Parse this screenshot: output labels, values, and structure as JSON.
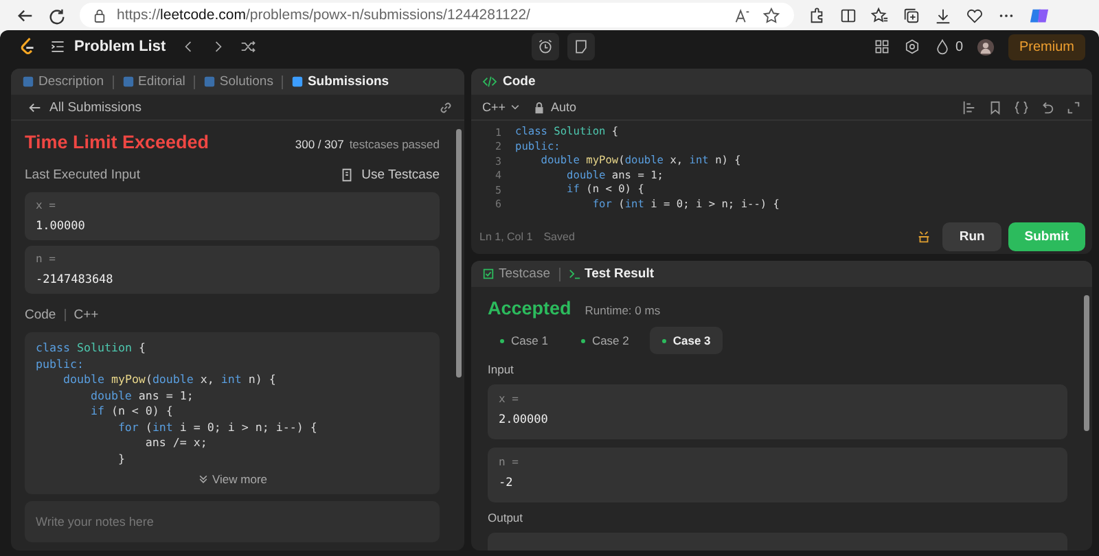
{
  "browser": {
    "url": "https://**leetcode.com**/problems/powx-n/submissions/1244281122/"
  },
  "header": {
    "title": "Problem List",
    "streak": "0",
    "premium": "Premium"
  },
  "left_tabs": [
    {
      "label": "Description",
      "selected": false
    },
    {
      "label": "Editorial",
      "selected": false
    },
    {
      "label": "Solutions",
      "selected": false
    },
    {
      "label": "Submissions",
      "selected": true
    }
  ],
  "submission": {
    "back": "All Submissions",
    "status": "Time Limit Exceeded",
    "passed": "300 / 307",
    "passed_label": "testcases passed",
    "input_label": "Last Executed Input",
    "use_testcase": "Use Testcase",
    "inputs": [
      {
        "name": "x =",
        "value": "1.00000"
      },
      {
        "name": "n =",
        "value": "-2147483648"
      }
    ],
    "code_label": "Code",
    "language": "C++",
    "code": [
      [
        {
          "text": "class ",
          "kind": "kw"
        },
        {
          "text": "Solution",
          "kind": "type"
        },
        {
          "text": " {",
          "kind": "plain"
        }
      ],
      [
        {
          "text": "public:",
          "kind": "kw"
        }
      ],
      [
        {
          "text": "    double ",
          "kind": "kw"
        },
        {
          "text": "myPow",
          "kind": "fn"
        },
        {
          "text": "(",
          "kind": "plain"
        },
        {
          "text": "double",
          "kind": "kw"
        },
        {
          "text": " x, ",
          "kind": "plain"
        },
        {
          "text": "int",
          "kind": "kw"
        },
        {
          "text": " n) {",
          "kind": "plain"
        }
      ],
      [
        {
          "text": "        double",
          "kind": "kw"
        },
        {
          "text": " ans = 1;",
          "kind": "plain"
        }
      ],
      [
        {
          "text": "        if",
          "kind": "kw"
        },
        {
          "text": " (n < 0) {",
          "kind": "plain"
        }
      ],
      [
        {
          "text": "            for",
          "kind": "kw"
        },
        {
          "text": " (",
          "kind": "plain"
        },
        {
          "text": "int",
          "kind": "kw"
        },
        {
          "text": " i = 0; i > n; i--) {",
          "kind": "plain"
        }
      ],
      [
        {
          "text": "                ans /= x;",
          "kind": "plain"
        }
      ],
      [
        {
          "text": "            }",
          "kind": "plain"
        }
      ]
    ],
    "view_more": "View more",
    "notes_placeholder": "Write your notes here"
  },
  "editor": {
    "title": "Code",
    "language": "C++",
    "mode": "Auto",
    "lines": [
      {
        "number": "1",
        "tokens": [
          {
            "text": "class ",
            "kind": "kw"
          },
          {
            "text": "Solution",
            "kind": "type"
          },
          {
            "text": " {",
            "kind": "plain"
          }
        ]
      },
      {
        "number": "2",
        "tokens": [
          {
            "text": "public:",
            "kind": "kw"
          }
        ]
      },
      {
        "number": "3",
        "tokens": [
          {
            "text": "    double ",
            "kind": "kw"
          },
          {
            "text": "myPow",
            "kind": "fn"
          },
          {
            "text": "(",
            "kind": "plain"
          },
          {
            "text": "double",
            "kind": "kw"
          },
          {
            "text": " x, ",
            "kind": "plain"
          },
          {
            "text": "int",
            "kind": "kw"
          },
          {
            "text": " n) {",
            "kind": "plain"
          }
        ]
      },
      {
        "number": "4",
        "tokens": [
          {
            "text": "        double",
            "kind": "kw"
          },
          {
            "text": " ans = 1;",
            "kind": "plain"
          }
        ]
      },
      {
        "number": "5",
        "tokens": [
          {
            "text": "        if",
            "kind": "kw"
          },
          {
            "text": " (n < 0) {",
            "kind": "plain"
          }
        ]
      },
      {
        "number": "6",
        "tokens": [
          {
            "text": "            for",
            "kind": "kw"
          },
          {
            "text": " (",
            "kind": "plain"
          },
          {
            "text": "int",
            "kind": "kw"
          },
          {
            "text": " i = 0; i > n; i--) {",
            "kind": "plain"
          }
        ]
      }
    ],
    "status": "Ln 1, Col 1",
    "saved": "Saved",
    "run": "Run",
    "submit": "Submit"
  },
  "results": {
    "tabs": [
      {
        "label": "Testcase",
        "selected": false
      },
      {
        "label": "Test Result",
        "selected": true
      }
    ],
    "status": "Accepted",
    "runtime": "Runtime: 0 ms",
    "cases": [
      {
        "label": "Case 1",
        "selected": false
      },
      {
        "label": "Case 2",
        "selected": false
      },
      {
        "label": "Case 3",
        "selected": true
      }
    ],
    "input_label": "Input",
    "inputs": [
      {
        "name": "x =",
        "value": "2.00000"
      },
      {
        "name": "n =",
        "value": "-2"
      }
    ],
    "output_label": "Output"
  }
}
